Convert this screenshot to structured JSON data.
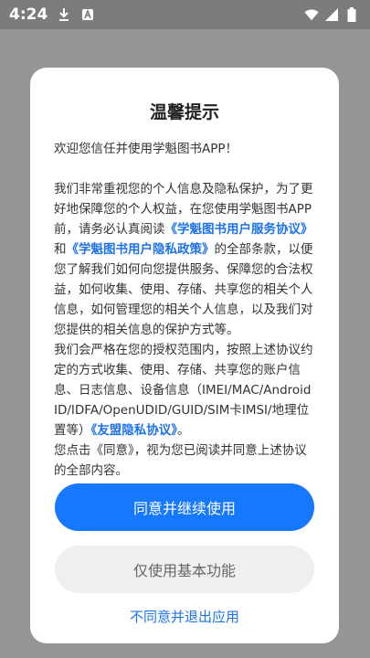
{
  "status_bar": {
    "time": "4:24",
    "icons_left": [
      "download-icon",
      "notification-a-icon"
    ],
    "icons_right": [
      "wifi-icon",
      "signal-icon",
      "battery-icon"
    ]
  },
  "dialog": {
    "title": "温馨提示",
    "welcome": "欢迎您信任并使用学魁图书APP！",
    "para1_pre": "我们非常重视您的个人信息及隐私保护，为了更好地保障您的个人权益，在您使用学魁图书APP前，请务必认真阅读",
    "link_service": "《学魁图书用户服务协议》",
    "para1_and": "和",
    "link_privacy": "《学魁图书用户隐私政策》",
    "para1_post": "的全部条款，以便您了解我们如何向您提供服务、保障您的合法权益，如何收集、使用、存储、共享您的相关个人信息，如何管理您的相关个人信息，以及我们对您提供的相关信息的保护方式等。",
    "para2_pre": "我们会严格在您的授权范围内，按照上述协议约定的方式收集、使用、存储、共享您的账户信息、日志信息、设备信息（IMEI/MAC/Android ID/IDFA/OpenUDID/GUID/SIM卡IMSI/地理位置等）",
    "link_umeng": "《友盟隐私协议》",
    "para2_post": "。",
    "para3": "您点击《同意》，视为您已阅读并同意上述协议的全部内容。"
  },
  "buttons": {
    "agree": "同意并继续使用",
    "basic_only": "仅使用基本功能",
    "disagree_exit": "不同意并退出应用"
  },
  "colors": {
    "primary": "#1677ff",
    "link": "#1e73e8",
    "secondary_bg": "#efefef",
    "backdrop": "#9a9a9a"
  }
}
